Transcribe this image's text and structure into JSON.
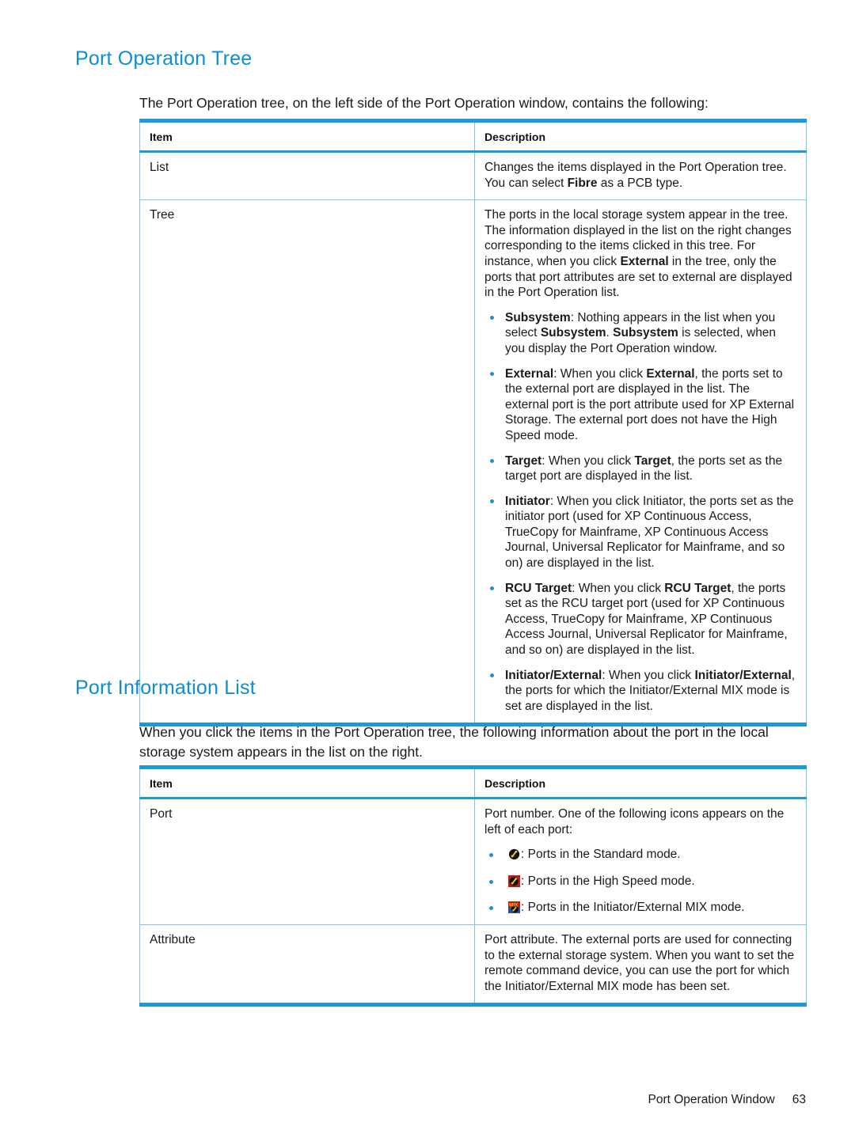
{
  "document": {
    "footer_title": "Port Operation Window",
    "page_number": "63"
  },
  "colors": {
    "heading_blue": "#0b8fd4",
    "table_rule_blue": "#1a9bd7",
    "table_hairline_blue": "#7fc4e8",
    "bullet_blue": "#2090cf"
  },
  "section1": {
    "title": "Port Operation Tree",
    "intro": "The Port Operation tree, on the left side of the Port Operation window, contains the following:",
    "table": {
      "headers": [
        "Item",
        "Description"
      ],
      "rows": [
        {
          "item": "List",
          "paragraphs": [
            "Changes the items displayed in the Port Operation tree. You can select ",
            " as a PCB type."
          ],
          "bold_inline": "Fibre"
        },
        {
          "item": "Tree",
          "intro_a": "The ports in the local storage system appear in the tree. The information displayed in the list on the right changes corresponding to the items clicked in this tree. For instance, when you click ",
          "intro_bold": "External",
          "intro_b": " in the tree, only the ports that port attributes are set to external are displayed in the Port Operation list.",
          "bullets": [
            {
              "parts": [
                {
                  "t": "Subsystem",
                  "b": true
                },
                {
                  "t": ": Nothing appears in the list when you select ",
                  "b": false
                },
                {
                  "t": "Subsystem",
                  "b": true
                },
                {
                  "t": ". ",
                  "b": false
                },
                {
                  "t": "Subsystem",
                  "b": true
                },
                {
                  "t": " is selected, when you display the Port Operation window.",
                  "b": false
                }
              ]
            },
            {
              "parts": [
                {
                  "t": "External",
                  "b": true
                },
                {
                  "t": ": When you click ",
                  "b": false
                },
                {
                  "t": "External",
                  "b": true
                },
                {
                  "t": ", the ports set to the external port are displayed in the list. The external port is the port attribute used for XP External Storage. The external port does not have the High Speed mode.",
                  "b": false
                }
              ]
            },
            {
              "parts": [
                {
                  "t": "Target",
                  "b": true
                },
                {
                  "t": ": When you click ",
                  "b": false
                },
                {
                  "t": "Target",
                  "b": true
                },
                {
                  "t": ", the ports set as the target port are displayed in the list.",
                  "b": false
                }
              ]
            },
            {
              "parts": [
                {
                  "t": "Initiator",
                  "b": true
                },
                {
                  "t": ": When you click Initiator, the ports set as the initiator port (used for XP Continuous Access, TrueCopy for Mainframe, XP Continuous Access Journal, Universal Replicator for Mainframe, and so on) are displayed in the list.",
                  "b": false
                }
              ]
            },
            {
              "parts": [
                {
                  "t": "RCU Target",
                  "b": true
                },
                {
                  "t": ": When you click ",
                  "b": false
                },
                {
                  "t": "RCU Target",
                  "b": true
                },
                {
                  "t": ", the ports set as the RCU target port (used for XP Continuous Access, TrueCopy for Mainframe, XP Continuous Access Journal, Universal Replicator for Mainframe, and so on) are displayed in the list.",
                  "b": false
                }
              ]
            },
            {
              "parts": [
                {
                  "t": "Initiator/External",
                  "b": true
                },
                {
                  "t": ": When you click ",
                  "b": false
                },
                {
                  "t": "Initiator/External",
                  "b": true
                },
                {
                  "t": ", the ports for which the Initiator/External MIX mode is set are displayed in the list.",
                  "b": false
                }
              ]
            }
          ]
        }
      ]
    }
  },
  "section2": {
    "title": "Port Information List",
    "intro": "When you click the items in the Port Operation tree, the following information about the port in the local storage system appears in the list on the right.",
    "table": {
      "headers": [
        "Item",
        "Description"
      ],
      "rows": [
        {
          "item": "Port",
          "intro": "Port number. One of the following icons appears on the left of each port:",
          "icon_bullets": [
            {
              "icon": "port-standard-mode-icon",
              "text": ": Ports in the Standard mode."
            },
            {
              "icon": "port-high-speed-mode-icon",
              "text": ": Ports in the High Speed mode."
            },
            {
              "icon": "port-initiator-external-mix-mode-icon",
              "text": ": Ports in the Initiator/External MIX mode."
            }
          ]
        },
        {
          "item": "Attribute",
          "text": "Port attribute. The external ports are used for connecting to the external storage system. When you want to set the remote command device, you can use the port for which the Initiator/External MIX mode has been set."
        }
      ]
    }
  }
}
